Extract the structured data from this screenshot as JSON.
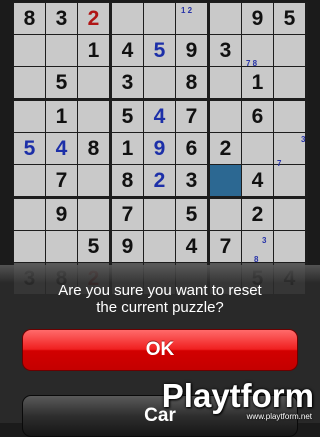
{
  "puzzle": {
    "rows": [
      [
        "8",
        "3",
        "2",
        "",
        "",
        "",
        "",
        "9",
        "5"
      ],
      [
        "",
        "",
        "1",
        "4",
        "5",
        "9",
        "3",
        "",
        ""
      ],
      [
        "",
        "5",
        "",
        "3",
        "",
        "8",
        "",
        "1",
        ""
      ],
      [
        "",
        "1",
        "",
        "5",
        "4",
        "7",
        "",
        "6",
        ""
      ],
      [
        "5",
        "4",
        "8",
        "1",
        "9",
        "6",
        "2",
        "",
        ""
      ],
      [
        "",
        "7",
        "",
        "8",
        "2",
        "3",
        "",
        "4",
        ""
      ],
      [
        "",
        "9",
        "",
        "7",
        "",
        "5",
        "",
        "2",
        ""
      ],
      [
        "",
        "",
        "5",
        "9",
        "",
        "4",
        "7",
        "",
        ""
      ],
      [
        "3",
        "8",
        "2",
        "",
        "",
        "",
        "",
        "5",
        "4"
      ]
    ],
    "colors": [
      [
        "#111111",
        "#111111",
        "#b01515",
        "#111111",
        "#111111",
        "#111111",
        "#111111",
        "#111111",
        "#111111"
      ],
      [
        "#111111",
        "#111111",
        "#111111",
        "#111111",
        "#1c2fa8",
        "#111111",
        "#111111",
        "#111111",
        "#111111"
      ],
      [
        "#111111",
        "#111111",
        "#111111",
        "#111111",
        "#111111",
        "#111111",
        "#111111",
        "#111111",
        "#111111"
      ],
      [
        "#111111",
        "#111111",
        "#111111",
        "#111111",
        "#1c2fa8",
        "#111111",
        "#111111",
        "#111111",
        "#111111"
      ],
      [
        "#1c2fa8",
        "#1c2fa8",
        "#111111",
        "#111111",
        "#1c2fa8",
        "#111111",
        "#111111",
        "#111111",
        "#111111"
      ],
      [
        "#111111",
        "#111111",
        "#111111",
        "#111111",
        "#1c2fa8",
        "#111111",
        "#111111",
        "#111111",
        "#111111"
      ],
      [
        "#111111",
        "#111111",
        "#111111",
        "#111111",
        "#111111",
        "#111111",
        "#111111",
        "#111111",
        "#111111"
      ],
      [
        "#111111",
        "#111111",
        "#111111",
        "#111111",
        "#111111",
        "#111111",
        "#111111",
        "#111111",
        "#111111"
      ],
      [
        "#111111",
        "#111111",
        "#b01515",
        "#111111",
        "#111111",
        "#111111",
        "#111111",
        "#111111",
        "#111111"
      ]
    ],
    "candidates": [
      {
        "row": 0,
        "col": 5,
        "text": "1 2"
      },
      {
        "row": 1,
        "col": 7,
        "text": "7 8"
      },
      {
        "row": 4,
        "col": 8,
        "text": "3"
      },
      {
        "row": 4,
        "col": 8,
        "text": "7"
      },
      {
        "row": 7,
        "col": 7,
        "text": "3"
      },
      {
        "row": 7,
        "col": 7,
        "text": "8"
      }
    ],
    "selected": {
      "row": 5,
      "col": 6
    },
    "selected_color": "#2c6892"
  },
  "dialog": {
    "message_line1": "Are you sure you want to reset",
    "message_line2": "the current puzzle?",
    "ok_label": "OK",
    "cancel_label": "Car"
  },
  "watermark": {
    "logo": "Playtform",
    "url": "www.playtform.net"
  }
}
